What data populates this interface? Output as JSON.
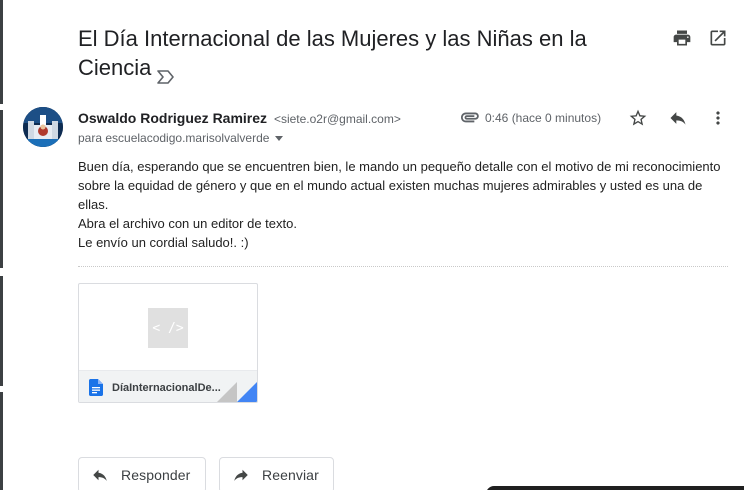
{
  "email": {
    "subject": "El Día Internacional de las Mujeres y las Niñas en la Ciencia",
    "sender_name": "Oswaldo Rodriguez Ramirez",
    "sender_email": "<siete.o2r@gmail.com>",
    "recipient": "para escuelacodigo.marisolvalverde",
    "time": "0:46 (hace 0 minutos)",
    "body": [
      "Buen día, esperando que se encuentren bien, le mando un pequeño detalle con el motivo de mi reconocimiento sobre la equidad de género y que en el mundo actual existen muchas mujeres admirables y usted es una de ellas.",
      "Abra el archivo con un editor de texto.",
      "Le envío un cordial saludo!. :)"
    ]
  },
  "attachment": {
    "thumb_glyph": "< />",
    "filename": "DíaInternacionalDe..."
  },
  "actions": {
    "reply_label": "Responder",
    "forward_label": "Reenviar"
  },
  "icons": {
    "print": "print-icon",
    "open_new_window": "open-in-new-window-icon",
    "important": "importance-marker-icon",
    "attachment": "paperclip-icon",
    "star": "star-icon",
    "reply": "reply-icon",
    "more": "more-vertical-icon",
    "doc": "google-docs-icon",
    "forward": "forward-icon"
  },
  "colors": {
    "accent_blue": "#4285f4",
    "doc_blue": "#1a73e8",
    "text_primary": "#202124",
    "text_secondary": "#5f6368"
  }
}
